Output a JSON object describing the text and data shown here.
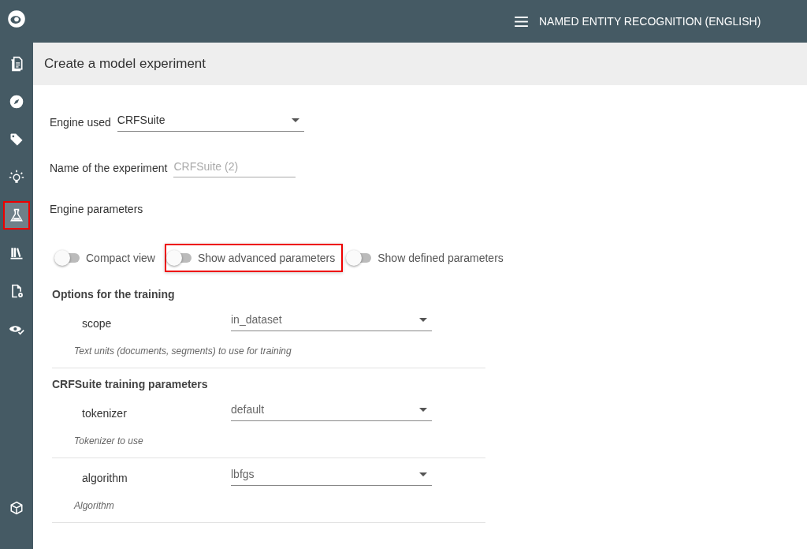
{
  "sidebar": {
    "items": [
      {
        "selected": false,
        "highlighted": false
      },
      {
        "selected": false,
        "highlighted": false
      },
      {
        "selected": false,
        "highlighted": false
      },
      {
        "selected": false,
        "highlighted": false
      },
      {
        "selected": true,
        "highlighted": true
      },
      {
        "selected": false,
        "highlighted": false
      },
      {
        "selected": false,
        "highlighted": false
      },
      {
        "selected": false,
        "highlighted": false
      }
    ],
    "bottom_item": {
      "selected": false,
      "highlighted": false
    }
  },
  "top_bar": {
    "title": "NAMED ENTITY RECOGNITION (ENGLISH)"
  },
  "page_header": "Create a model experiment",
  "engine": {
    "label": "Engine used",
    "value": "CRFSuite"
  },
  "experiment_name": {
    "label": "Name of the experiment",
    "placeholder": "CRFSuite (2)"
  },
  "engine_parameters_label": "Engine parameters",
  "toggles": [
    {
      "label": "Compact view",
      "on": false,
      "highlighted": false
    },
    {
      "label": "Show advanced parameters",
      "on": false,
      "highlighted": true
    },
    {
      "label": "Show defined parameters",
      "on": false,
      "highlighted": false
    }
  ],
  "sections": [
    {
      "title": "Options for the training",
      "params": [
        {
          "name": "scope",
          "value": "in_dataset",
          "description": "Text units (documents, segments) to use for training"
        }
      ]
    },
    {
      "title": "CRFSuite training parameters",
      "params": [
        {
          "name": "tokenizer",
          "value": "default",
          "description": "Tokenizer to use"
        },
        {
          "name": "algorithm",
          "value": "lbfgs",
          "description": "Algorithm"
        }
      ]
    }
  ]
}
